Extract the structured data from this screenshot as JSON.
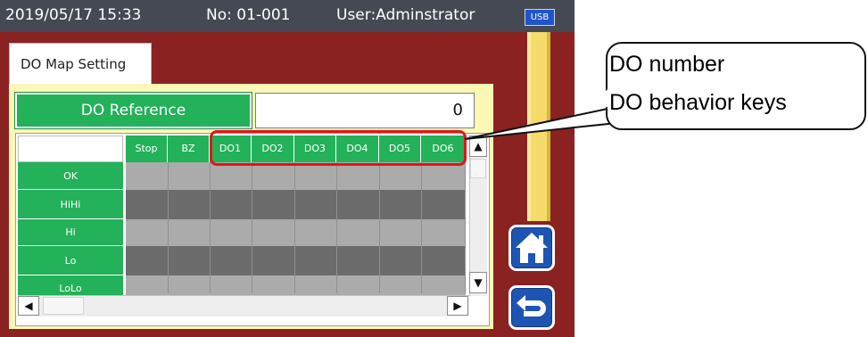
{
  "header": {
    "datetime": "2019/05/17 15:33",
    "number": "No: 01-001",
    "user": "User:Adminstrator",
    "usb_badge": "USB"
  },
  "tab": {
    "label": "DO Map Setting"
  },
  "reference": {
    "button_label": "DO Reference",
    "value": "0"
  },
  "grid": {
    "columns": [
      "Stop",
      "BZ",
      "DO1",
      "DO2",
      "DO3",
      "DO4",
      "DO5",
      "DO6"
    ],
    "rows": [
      "OK",
      "HiHi",
      "Hi",
      "Lo",
      "LoLo"
    ]
  },
  "scroll": {
    "up": "▲",
    "down": "▼",
    "left": "◀",
    "right": "▶"
  },
  "callout": {
    "line1": "DO number",
    "line2": "DO behavior keys"
  },
  "colors": {
    "header_bg": "#444953",
    "frame_maroon": "#8a2222",
    "panel_yellow": "#fdf7b6",
    "key_green": "#23b15a",
    "nav_blue": "#1e55b4",
    "highlight_red": "#e3141b"
  },
  "icons": {
    "home": "home-icon",
    "back": "return-arrow-icon"
  }
}
